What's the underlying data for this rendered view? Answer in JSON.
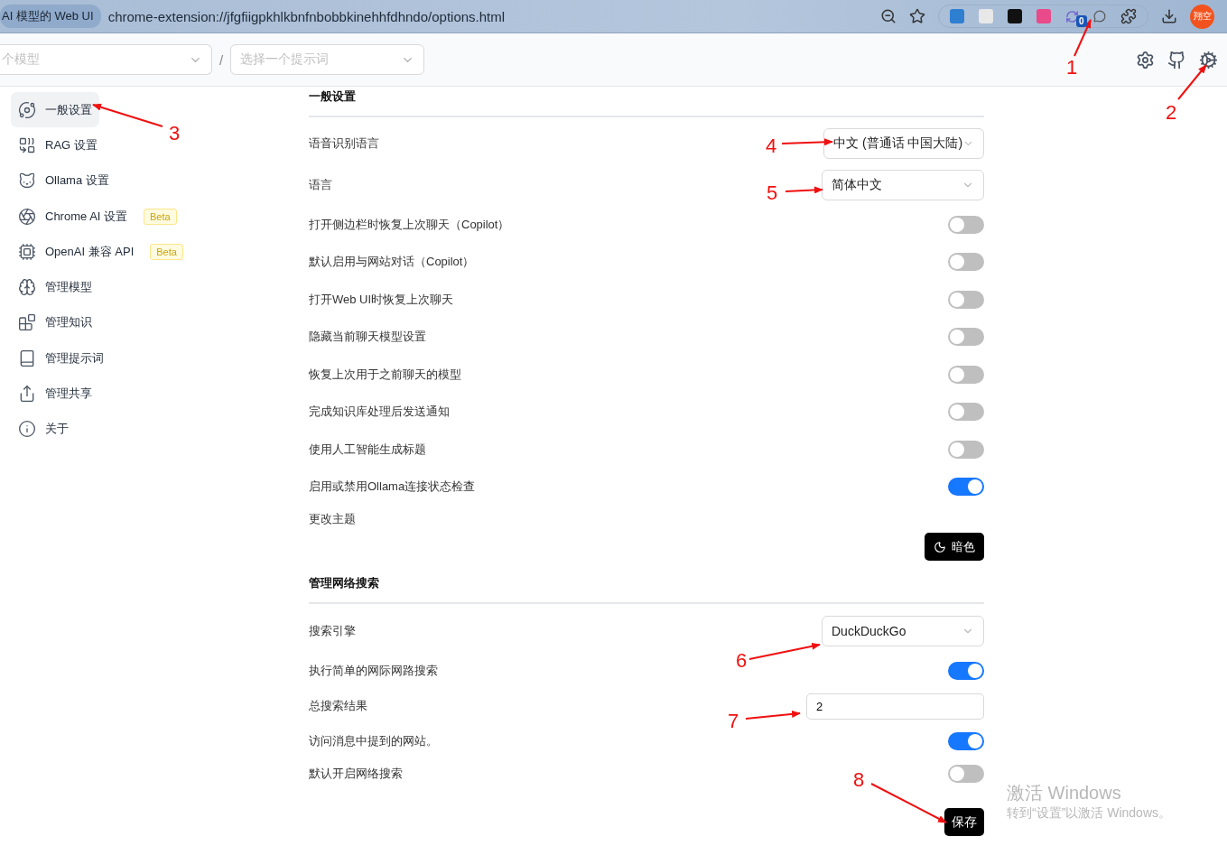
{
  "browser": {
    "tab_title": "AI 模型的 Web UI",
    "url": "chrome-extension://jfgfiigpkhlkbnfnbobbkinehhfdhndo/options.html",
    "extension_badge": "0",
    "profile": "翔空"
  },
  "header": {
    "model_select": {
      "placeholder": "个模型"
    },
    "separator": "/",
    "prompt_select": {
      "placeholder": "选择一个提示词"
    }
  },
  "sidebar": {
    "items": [
      {
        "label": "一般设置",
        "selected": true
      },
      {
        "label": "RAG 设置",
        "selected": false
      },
      {
        "label": "Ollama 设置",
        "selected": false
      },
      {
        "label": "Chrome AI 设置",
        "selected": false,
        "badge": "Beta"
      },
      {
        "label": "OpenAI 兼容 API",
        "selected": false,
        "badge": "Beta"
      },
      {
        "label": "管理模型",
        "selected": false
      },
      {
        "label": "管理知识",
        "selected": false
      },
      {
        "label": "管理提示词",
        "selected": false
      },
      {
        "label": "管理共享",
        "selected": false
      },
      {
        "label": "关于",
        "selected": false
      }
    ]
  },
  "sections": [
    {
      "title": "一般设置",
      "rows": [
        {
          "kind": "select",
          "label": "语音识别语言",
          "value": "中文 (普通话 中国大陆)"
        },
        {
          "kind": "select",
          "label": "语言",
          "value": "简体中文"
        },
        {
          "kind": "toggle",
          "label": "打开侧边栏时恢复上次聊天（Copilot）",
          "on": false
        },
        {
          "kind": "toggle",
          "label": "默认启用与网站对话（Copilot）",
          "on": false
        },
        {
          "kind": "toggle",
          "label": "打开Web UI时恢复上次聊天",
          "on": false
        },
        {
          "kind": "toggle",
          "label": "隐藏当前聊天模型设置",
          "on": false
        },
        {
          "kind": "toggle",
          "label": "恢复上次用于之前聊天的模型",
          "on": false
        },
        {
          "kind": "toggle",
          "label": "完成知识库处理后发送通知",
          "on": false
        },
        {
          "kind": "toggle",
          "label": "使用人工智能生成标题",
          "on": false
        },
        {
          "kind": "toggle",
          "label": "启用或禁用Ollama连接状态检查",
          "on": true
        },
        {
          "kind": "button",
          "label": "更改主题",
          "button": "暗色"
        }
      ]
    },
    {
      "title": "管理网络搜索",
      "rows": [
        {
          "kind": "select",
          "label": "搜索引擎",
          "value": "DuckDuckGo"
        },
        {
          "kind": "toggle",
          "label": "执行简单的网际网路搜索",
          "on": true
        },
        {
          "kind": "input",
          "label": "总搜索结果",
          "value": "2"
        },
        {
          "kind": "toggle",
          "label": "访问消息中提到的网站。",
          "on": true
        },
        {
          "kind": "toggle",
          "label": "默认开启网络搜索",
          "on": false
        }
      ]
    }
  ],
  "save_button": "保存",
  "annotations": [
    "1",
    "2",
    "3",
    "4",
    "5",
    "6",
    "7",
    "8"
  ],
  "windows_notice": {
    "title": "激活 Windows",
    "text": "转到“设置”以激活 Windows。"
  }
}
